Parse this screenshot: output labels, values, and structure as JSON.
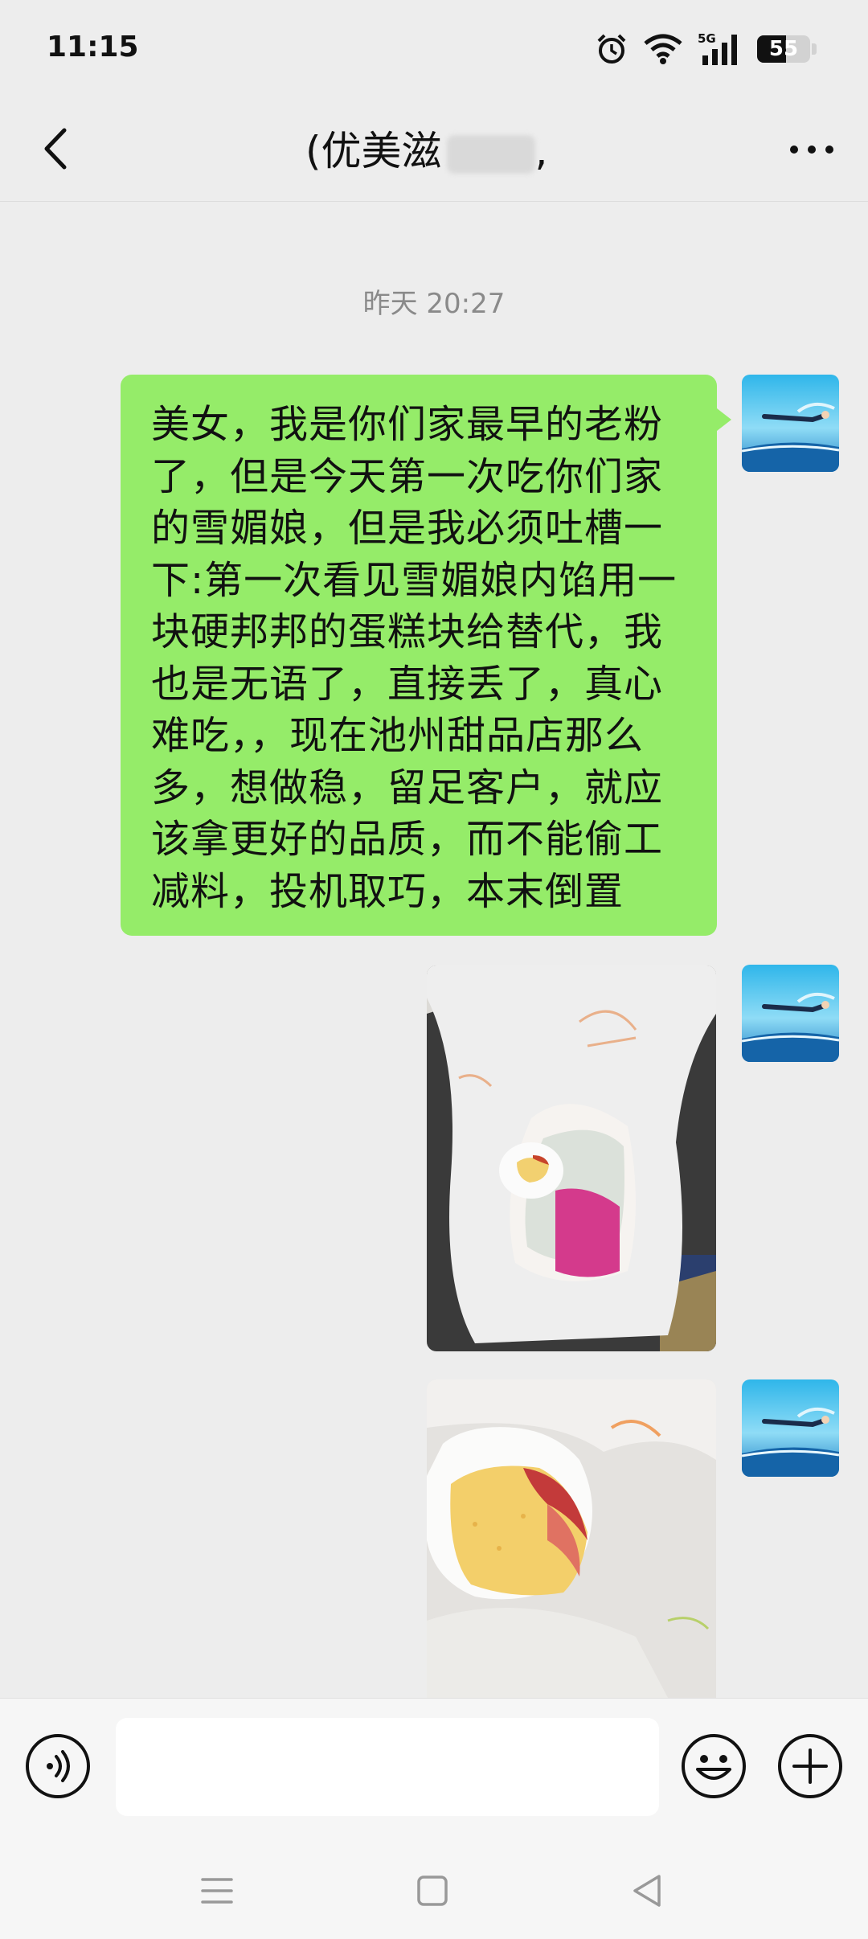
{
  "status": {
    "time": "11:15",
    "battery_level": "55"
  },
  "header": {
    "title_visible": "(优美滋",
    "title_suffix": ","
  },
  "chat": {
    "timestamp": "昨天 20:27",
    "messages": [
      {
        "type": "text",
        "lines": [
          "美女，我是你们家最早的老粉",
          "了，但是今天第一次吃你们家",
          "的雪媚娘，但是我必须吐槽一",
          "下:第一次看见雪媚娘内馅用一",
          "块硬邦邦的蛋糕块给替代，我",
          "也是无语了，直接丢了，真心",
          "难吃，，现在池州甜品店那么",
          "多，想做稳，留足客户，就应",
          "该拿更好的品质，而不能偷工",
          "减料，投机取巧，本末倒置"
        ]
      },
      {
        "type": "image",
        "description": "photo-bag-with-snow-mochi"
      },
      {
        "type": "image",
        "description": "photo-snow-mochi-cut-open"
      }
    ]
  },
  "input": {
    "value": "",
    "placeholder": ""
  },
  "icons": {
    "back": "back-arrow-icon",
    "more": "more-dots-icon",
    "voice": "voice-icon",
    "emoji": "emoji-icon",
    "plus": "plus-icon",
    "menu": "menu-icon",
    "home": "home-icon",
    "recent": "back-triangle-icon"
  },
  "colors": {
    "bubble": "#95ec69",
    "background": "#ededed"
  }
}
